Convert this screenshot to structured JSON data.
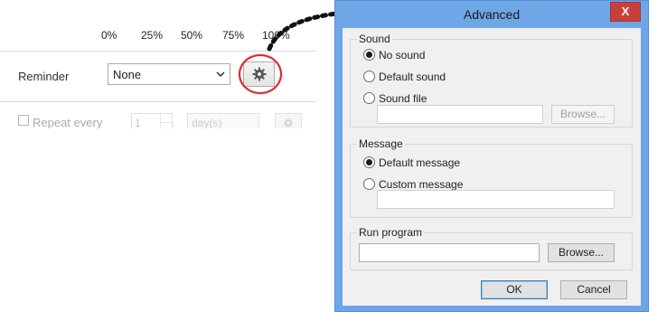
{
  "background_app": {
    "percent_scale": [
      "0%",
      "25%",
      "50%",
      "75%",
      "100%"
    ],
    "reminder_label": "Reminder",
    "reminder_value": "None",
    "repeat_label": "Repeat every",
    "repeat_value": "1",
    "repeat_unit": "day(s)"
  },
  "dialog": {
    "title": "Advanced",
    "close_glyph": "X",
    "sound": {
      "legend": "Sound",
      "options": [
        "No sound",
        "Default sound",
        "Sound file"
      ],
      "selected": "No sound",
      "file_value": "",
      "browse_label": "Browse..."
    },
    "message": {
      "legend": "Message",
      "options": [
        "Default message",
        "Custom message"
      ],
      "selected": "Default message",
      "custom_value": ""
    },
    "run_program": {
      "legend": "Run program",
      "value": "",
      "browse_label": "Browse..."
    },
    "ok_label": "OK",
    "cancel_label": "Cancel"
  },
  "colors": {
    "dialog_frame": "#6fa6e6",
    "highlight_ring": "#d9262b",
    "close_button": "#c7413a"
  }
}
